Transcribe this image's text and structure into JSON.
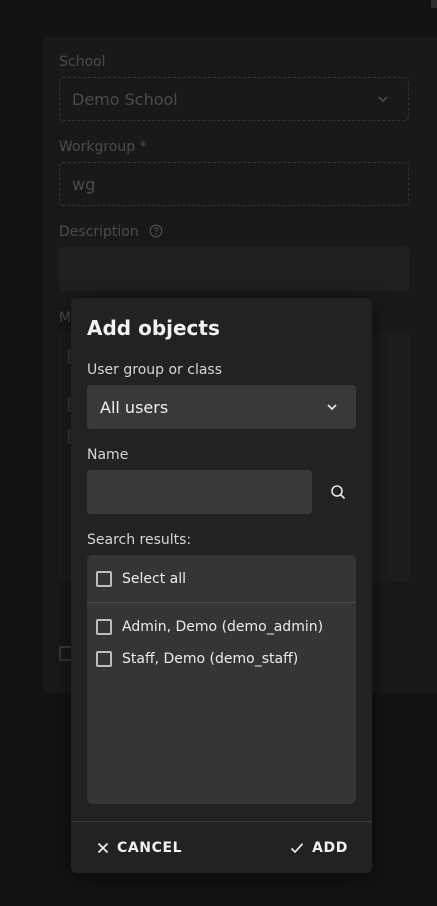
{
  "background": {
    "school_label": "School",
    "school_value": "Demo School",
    "workgroup_label": "Workgroup *",
    "workgroup_value": "wg",
    "description_label": "Description",
    "members_label_partial": "M"
  },
  "dialog": {
    "title": "Add objects",
    "group_label": "User group or class",
    "group_value": "All users",
    "name_label": "Name",
    "name_value": "",
    "results_label": "Search results:",
    "select_all": "Select all",
    "results": [
      {
        "label": "Admin, Demo (demo_admin)",
        "checked": false
      },
      {
        "label": "Staff, Demo (demo_staff)",
        "checked": false
      }
    ],
    "cancel_label": "CANCEL",
    "add_label": "ADD"
  },
  "colors": {
    "page_bg": "#1c1c1c",
    "dialog_bg": "#222222",
    "field_bg": "#393939",
    "results_bg": "#353535",
    "text": "#f2f2f2"
  },
  "icons": {
    "select_chevron": "chevron-down-icon",
    "search": "search-icon",
    "cancel": "close-icon",
    "add": "check-icon",
    "help": "help-circle-icon"
  }
}
